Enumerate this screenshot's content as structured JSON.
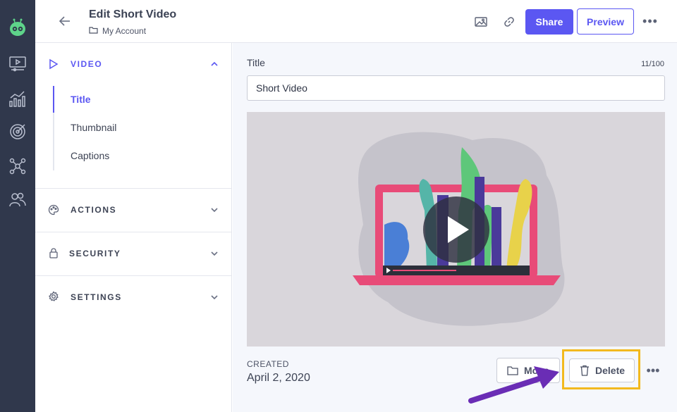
{
  "header": {
    "title": "Edit Short Video",
    "breadcrumb": "My Account",
    "share_label": "Share",
    "preview_label": "Preview"
  },
  "sidebar": {
    "video": {
      "label": "VIDEO",
      "items": [
        {
          "label": "Title",
          "active": true
        },
        {
          "label": "Thumbnail"
        },
        {
          "label": "Captions"
        }
      ]
    },
    "actions_label": "ACTIONS",
    "security_label": "SECURITY",
    "settings_label": "SETTINGS"
  },
  "main": {
    "title_label": "Title",
    "counter": "11/100",
    "title_value": "Short Video",
    "created_label": "CREATED",
    "created_date": "April 2, 2020",
    "move_label": "Move",
    "delete_label": "Delete"
  },
  "colors": {
    "accent": "#5b57f2",
    "rail": "#30384c",
    "highlight": "#f2b91e",
    "annotation_arrow": "#6a2db5"
  },
  "icons": [
    "robot-logo-icon",
    "video-library-icon",
    "analytics-icon",
    "target-icon",
    "network-icon",
    "users-icon",
    "back-arrow-icon",
    "folder-icon",
    "image-icon",
    "link-icon",
    "more-icon",
    "play-outline-icon",
    "chevron-up-icon",
    "chevron-down-icon",
    "palette-icon",
    "lock-icon",
    "gear-icon",
    "trash-icon",
    "play-icon"
  ]
}
